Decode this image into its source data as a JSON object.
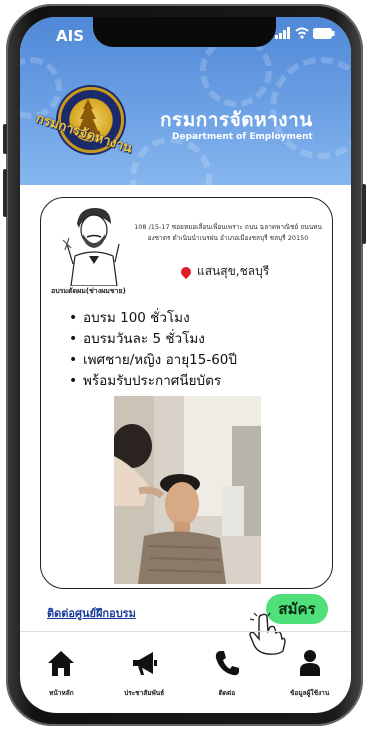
{
  "status_bar": {
    "carrier": "AIS"
  },
  "header": {
    "title_th": "กรมการจัดหางาน",
    "title_en": "Department of Employment",
    "seal_text": "กรมการจัดหางาน"
  },
  "course": {
    "name": "อบรมตัดผม(ช่างผมชาย)",
    "address": "108 /15-17 ซอยหมอเลื่อนเพื่อนเพราะ ถนน ฉลาดพาณิชย์ ถนนหนองชาตร ดำเนินนำเนรฝน อำเภอเมืองชลบุรี ชลบุรี 20150",
    "location": "แสนสุข,ชลบุรี",
    "details": [
      "อบรม 100 ชั่วโมง",
      "อบรมวันละ 5 ชั่วโมง",
      "เพศชาย/หญิง อายุ15-60ปี",
      "พร้อมรับประกาศนียบัตร"
    ]
  },
  "actions": {
    "contact_link": "ติดต่อศูนย์ฝึกอบรม",
    "apply_label": "สมัคร"
  },
  "nav": [
    {
      "label": "หน้าหลัก",
      "icon": "home-icon"
    },
    {
      "label": "ประชาสัมพันธ์",
      "icon": "megaphone-icon"
    },
    {
      "label": "ติดต่อ",
      "icon": "phone-icon"
    },
    {
      "label": "ข้อมูลผู้ใช้งาน",
      "icon": "user-icon"
    }
  ],
  "colors": {
    "header_blue": "#4f88d6",
    "apply_green": "#4fe07a",
    "link_blue": "#1c3c9a",
    "pin_red": "#e21d2a"
  }
}
